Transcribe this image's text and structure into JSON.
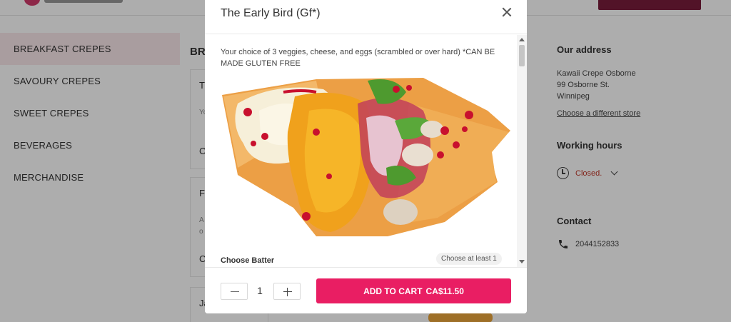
{
  "menu": {
    "categories": [
      {
        "label": "BREAKFAST CREPES"
      },
      {
        "label": "SAVOURY CREPES"
      },
      {
        "label": "SWEET CREPES"
      },
      {
        "label": "BEVERAGES"
      },
      {
        "label": "MERCHANDISE"
      }
    ],
    "active_category": "BREAKFAST CREPES",
    "section_heading": "BR"
  },
  "cards": [
    {
      "title": "T",
      "desc": "Yo",
      "price": "C"
    },
    {
      "title": "F",
      "desc": "A o",
      "price": "C"
    },
    {
      "title": "Ja",
      "desc": "",
      "price": ""
    }
  ],
  "store": {
    "address_heading": "Our address",
    "address_lines": [
      "Kawaii Crepe Osborne",
      "99 Osborne St.",
      "Winnipeg"
    ],
    "change_store_link": "Choose a different store",
    "hours_heading": "Working hours",
    "hours_status": "Closed.",
    "contact_heading": "Contact",
    "phone": "2044152833"
  },
  "modal": {
    "title": "The Early Bird (Gf*)",
    "description": "Your choice of 3 veggies, cheese, and eggs (scrambled or over hard) *CAN BE MADE GLUTEN FREE",
    "choose_batter_label": "Choose Batter",
    "choose_batter_hint": "Choose at least 1",
    "quantity": "1",
    "add_to_cart_label": "ADD TO CART",
    "price": "CA$11.50"
  },
  "colors": {
    "accent": "#e91e63",
    "active_category_bg": "#fae8ea",
    "closed_status": "#c0392b"
  },
  "icons": [
    "close-icon",
    "minus-icon",
    "plus-icon",
    "clock-icon",
    "chevron-down-icon",
    "phone-icon"
  ]
}
